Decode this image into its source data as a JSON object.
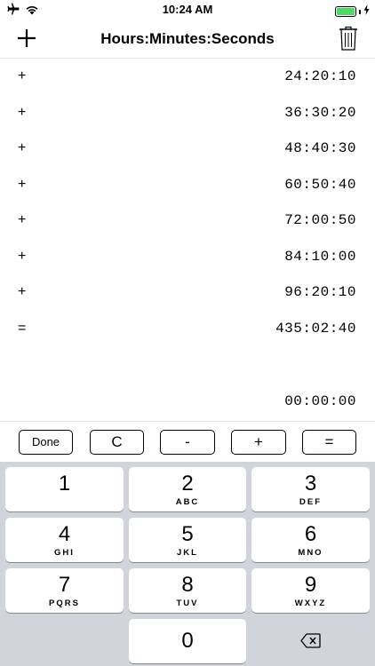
{
  "status_bar": {
    "time": "10:24 AM",
    "icons": [
      "airplane-icon",
      "wifi-icon",
      "battery-charging-icon"
    ],
    "battery_color": "#4cd964"
  },
  "nav": {
    "title": "Hours:Minutes:Seconds",
    "left_icon": "plus-icon",
    "right_icon": "trash-icon"
  },
  "tape": {
    "rows": [
      {
        "op": "+",
        "value": "24:20:10"
      },
      {
        "op": "+",
        "value": "36:30:20"
      },
      {
        "op": "+",
        "value": "48:40:30"
      },
      {
        "op": "+",
        "value": "60:50:40"
      },
      {
        "op": "+",
        "value": "72:00:50"
      },
      {
        "op": "+",
        "value": "84:10:00"
      },
      {
        "op": "+",
        "value": "96:20:10"
      },
      {
        "op": "=",
        "value": "435:02:40"
      }
    ],
    "current": "00:00:00"
  },
  "ops": {
    "done": "Done",
    "clear": "C",
    "minus": "-",
    "plus": "+",
    "equals": "="
  },
  "keypad": {
    "keys": [
      {
        "num": "1",
        "letters": ""
      },
      {
        "num": "2",
        "letters": "ABC"
      },
      {
        "num": "3",
        "letters": "DEF"
      },
      {
        "num": "4",
        "letters": "GHI"
      },
      {
        "num": "5",
        "letters": "JKL"
      },
      {
        "num": "6",
        "letters": "MNO"
      },
      {
        "num": "7",
        "letters": "PQRS"
      },
      {
        "num": "8",
        "letters": "TUV"
      },
      {
        "num": "9",
        "letters": "WXYZ"
      },
      {
        "num": "0",
        "letters": ""
      }
    ],
    "delete_icon": "backspace-icon",
    "background": "#d1d5db"
  }
}
